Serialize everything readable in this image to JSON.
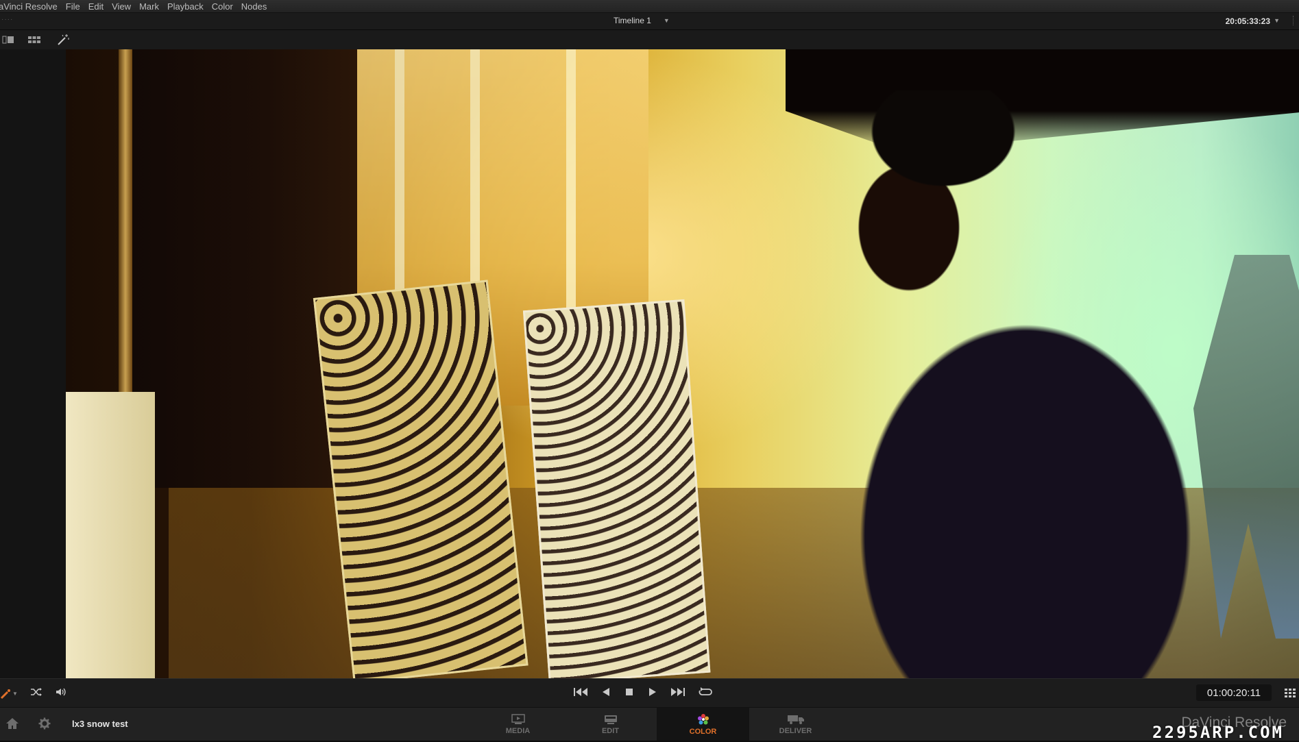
{
  "app": {
    "name": "aVinci Resolve"
  },
  "menu": [
    "File",
    "Edit",
    "View",
    "Mark",
    "Playback",
    "Color",
    "Nodes"
  ],
  "titlebar": {
    "timeline": "Timeline 1",
    "clock": "20:05:33:23"
  },
  "toolbar": {
    "icons": [
      "single-viewer-icon",
      "grid-viewer-icon",
      "magic-wand-icon"
    ]
  },
  "transport": {
    "timecode": "01:00:20:11",
    "left_icons": [
      "brush-icon",
      "shuffle-icon",
      "speaker-icon"
    ],
    "center_icons": [
      "skip-to-start-icon",
      "play-reverse-icon",
      "stop-icon",
      "play-icon",
      "skip-to-end-icon",
      "loop-icon"
    ]
  },
  "pagebar": {
    "project": "lx3 snow test",
    "tabs": [
      {
        "label": "MEDIA",
        "active": false
      },
      {
        "label": "EDIT",
        "active": false
      },
      {
        "label": "COLOR",
        "active": true
      },
      {
        "label": "DELIVER",
        "active": false
      }
    ],
    "brand": "DaVinci Resolve",
    "watermark": "2295ARP.COM"
  },
  "colors": {
    "accent": "#e0702a",
    "background": "#1c1c1c"
  }
}
